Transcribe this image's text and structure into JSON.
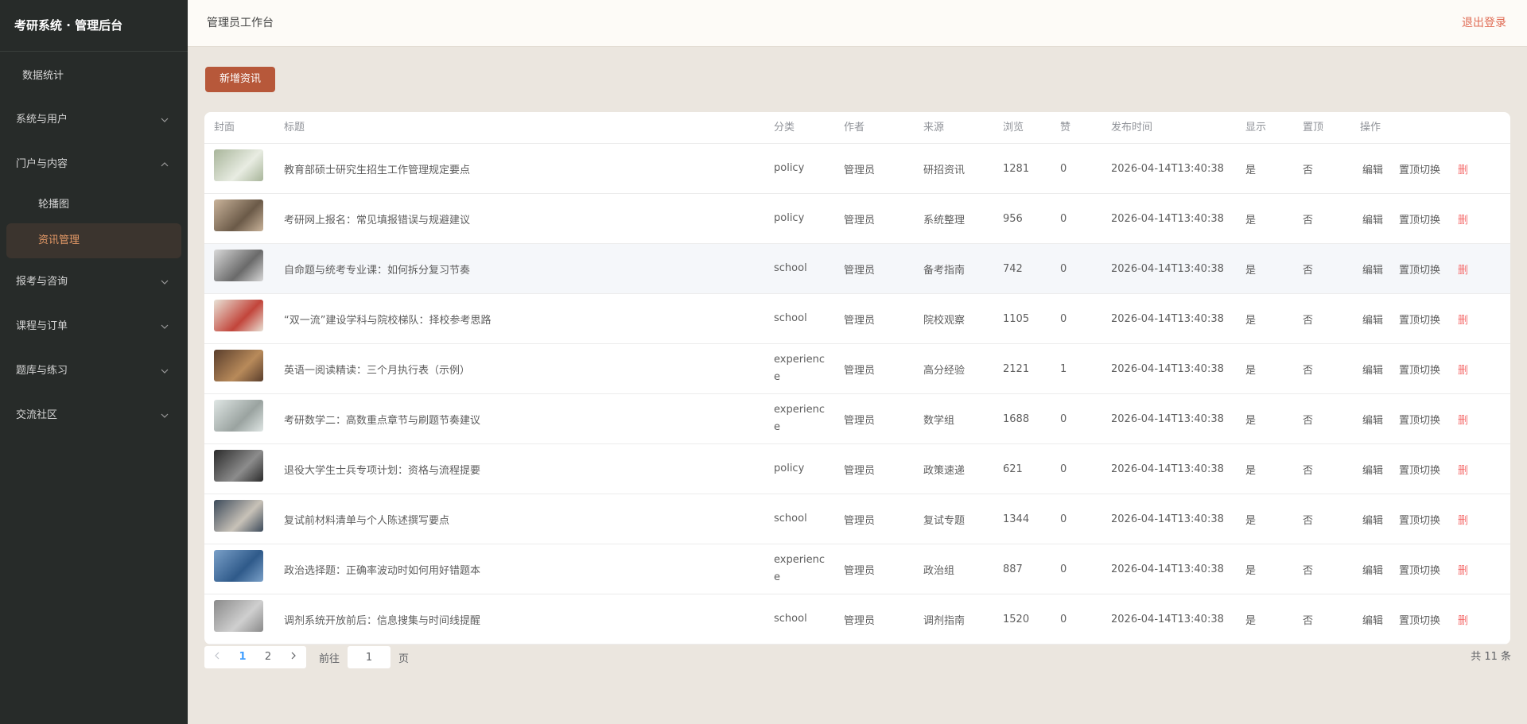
{
  "sidebar": {
    "brand": "考研系统 · 管理后台",
    "items": [
      {
        "label": "数据统计"
      },
      {
        "label": "系统与用户"
      },
      {
        "label": "门户与内容"
      },
      {
        "label": "轮播图"
      },
      {
        "label": "资讯管理"
      },
      {
        "label": "报考与咨询"
      },
      {
        "label": "课程与订单"
      },
      {
        "label": "题库与练习"
      },
      {
        "label": "交流社区"
      }
    ]
  },
  "header": {
    "title": "管理员工作台",
    "logout": "退出登录"
  },
  "toolbar": {
    "add_label": "新增资讯"
  },
  "table": {
    "columns": {
      "cover": "封面",
      "title": "标题",
      "category": "分类",
      "author": "作者",
      "source": "来源",
      "views": "浏览",
      "likes": "赞",
      "published": "发布时间",
      "visible": "显示",
      "pinned": "置顶",
      "ops": "操作"
    },
    "actions": {
      "edit": "编辑",
      "pin_toggle": "置顶切换",
      "delete": "删"
    },
    "rows": [
      {
        "title": "教育部硕士研究生招生工作管理规定要点",
        "category": "policy",
        "author": "管理员",
        "source": "研招资讯",
        "views": "1281",
        "likes": "0",
        "published": "2026-04-14T13:40:38",
        "visible": "是",
        "pinned": "否"
      },
      {
        "title": "考研网上报名：常见填报错误与规避建议",
        "category": "policy",
        "author": "管理员",
        "source": "系统整理",
        "views": "956",
        "likes": "0",
        "published": "2026-04-14T13:40:38",
        "visible": "是",
        "pinned": "否"
      },
      {
        "title": "自命题与统考专业课：如何拆分复习节奏",
        "category": "school",
        "author": "管理员",
        "source": "备考指南",
        "views": "742",
        "likes": "0",
        "published": "2026-04-14T13:40:38",
        "visible": "是",
        "pinned": "否"
      },
      {
        "title": "“双一流”建设学科与院校梯队：择校参考思路",
        "category": "school",
        "author": "管理员",
        "source": "院校观察",
        "views": "1105",
        "likes": "0",
        "published": "2026-04-14T13:40:38",
        "visible": "是",
        "pinned": "否"
      },
      {
        "title": "英语一阅读精读：三个月执行表（示例）",
        "category": "experience",
        "author": "管理员",
        "source": "高分经验",
        "views": "2121",
        "likes": "1",
        "published": "2026-04-14T13:40:38",
        "visible": "是",
        "pinned": "否"
      },
      {
        "title": "考研数学二：高数重点章节与刷题节奏建议",
        "category": "experience",
        "author": "管理员",
        "source": "数学组",
        "views": "1688",
        "likes": "0",
        "published": "2026-04-14T13:40:38",
        "visible": "是",
        "pinned": "否"
      },
      {
        "title": "退役大学生士兵专项计划：资格与流程提要",
        "category": "policy",
        "author": "管理员",
        "source": "政策速递",
        "views": "621",
        "likes": "0",
        "published": "2026-04-14T13:40:38",
        "visible": "是",
        "pinned": "否"
      },
      {
        "title": "复试前材料清单与个人陈述撰写要点",
        "category": "school",
        "author": "管理员",
        "source": "复试专题",
        "views": "1344",
        "likes": "0",
        "published": "2026-04-14T13:40:38",
        "visible": "是",
        "pinned": "否"
      },
      {
        "title": "政治选择题：正确率波动时如何用好错题本",
        "category": "experience",
        "author": "管理员",
        "source": "政治组",
        "views": "887",
        "likes": "0",
        "published": "2026-04-14T13:40:38",
        "visible": "是",
        "pinned": "否"
      },
      {
        "title": "调剂系统开放前后：信息搜集与时间线提醒",
        "category": "school",
        "author": "管理员",
        "source": "调剂指南",
        "views": "1520",
        "likes": "0",
        "published": "2026-04-14T13:40:38",
        "visible": "是",
        "pinned": "否"
      }
    ]
  },
  "pagination": {
    "pages": [
      "1",
      "2"
    ],
    "current": "1",
    "goto_prefix": "前往",
    "goto_value": "1",
    "goto_suffix": "页",
    "total": "共 11 条"
  }
}
